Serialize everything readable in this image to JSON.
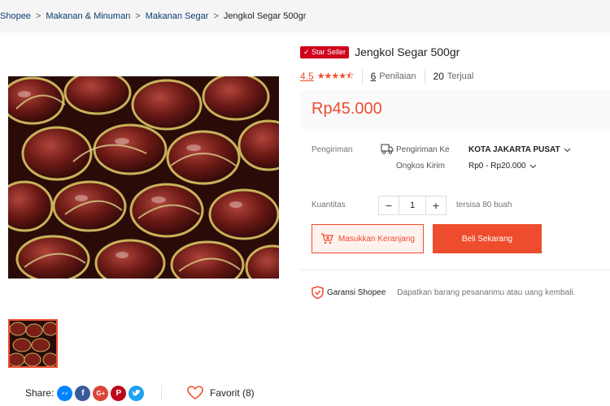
{
  "breadcrumb": {
    "items": [
      "Shopee",
      "Makanan & Minuman",
      "Makanan Segar",
      "Jengkol Segar 500gr"
    ],
    "separator": ">"
  },
  "product": {
    "badge": "✓ Star Seller",
    "title": "Jengkol Segar 500gr",
    "rating": "4.5",
    "stars": "★★★★⯪",
    "rating_count": "6",
    "rating_label": "Penilaian",
    "sold_count": "20",
    "sold_label": "Terjual",
    "price": "Rp45.000"
  },
  "shipping": {
    "label": "Pengiriman",
    "to_label": "Pengiriman Ke",
    "to_value": "KOTA JAKARTA PUSAT",
    "cost_label": "Ongkos Kirim",
    "cost_value": "Rp0 - Rp20.000"
  },
  "quantity": {
    "label": "Kuantitas",
    "minus": "−",
    "value": "1",
    "plus": "+",
    "stock": "tersisa 80 buah"
  },
  "actions": {
    "add_to_cart": "Masukkan Keranjang",
    "buy_now": "Beli Sekarang"
  },
  "guarantee": {
    "title": "Garansi Shopee",
    "description": "Dapatkan barang pesananmu atau uang kembali."
  },
  "share": {
    "label": "Share:",
    "networks": [
      "messenger-icon",
      "facebook-icon",
      "google-plus-icon",
      "pinterest-icon",
      "twitter-icon"
    ]
  },
  "favorite": {
    "label": "Favorit (8)"
  },
  "colors": {
    "accent": "#ee4d2d",
    "badge": "#d0011b",
    "price_bg": "#fafafa",
    "breadcrumb_bg": "#f5f5f5"
  }
}
